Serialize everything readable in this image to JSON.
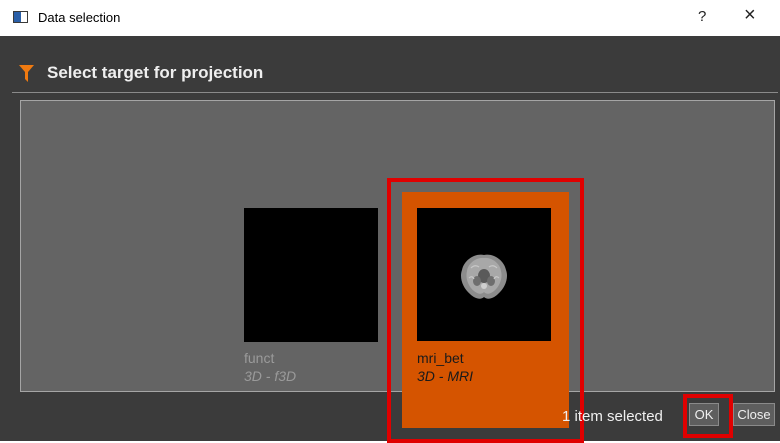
{
  "window": {
    "title": "Data selection",
    "help_label": "?",
    "close_label": "×"
  },
  "dialog": {
    "header_title": "Select target for projection",
    "accent_color": "#d55400",
    "items": [
      {
        "name": "funct",
        "type": "3D - f3D",
        "selected": false
      },
      {
        "name": "mri_bet",
        "type": "3D - MRI",
        "selected": true
      }
    ],
    "status_text": "1 item selected",
    "ok_label": "OK",
    "close_label": "Close"
  },
  "icons": [
    "window-icon",
    "filter-icon",
    "brain-scan-thumbnail"
  ]
}
